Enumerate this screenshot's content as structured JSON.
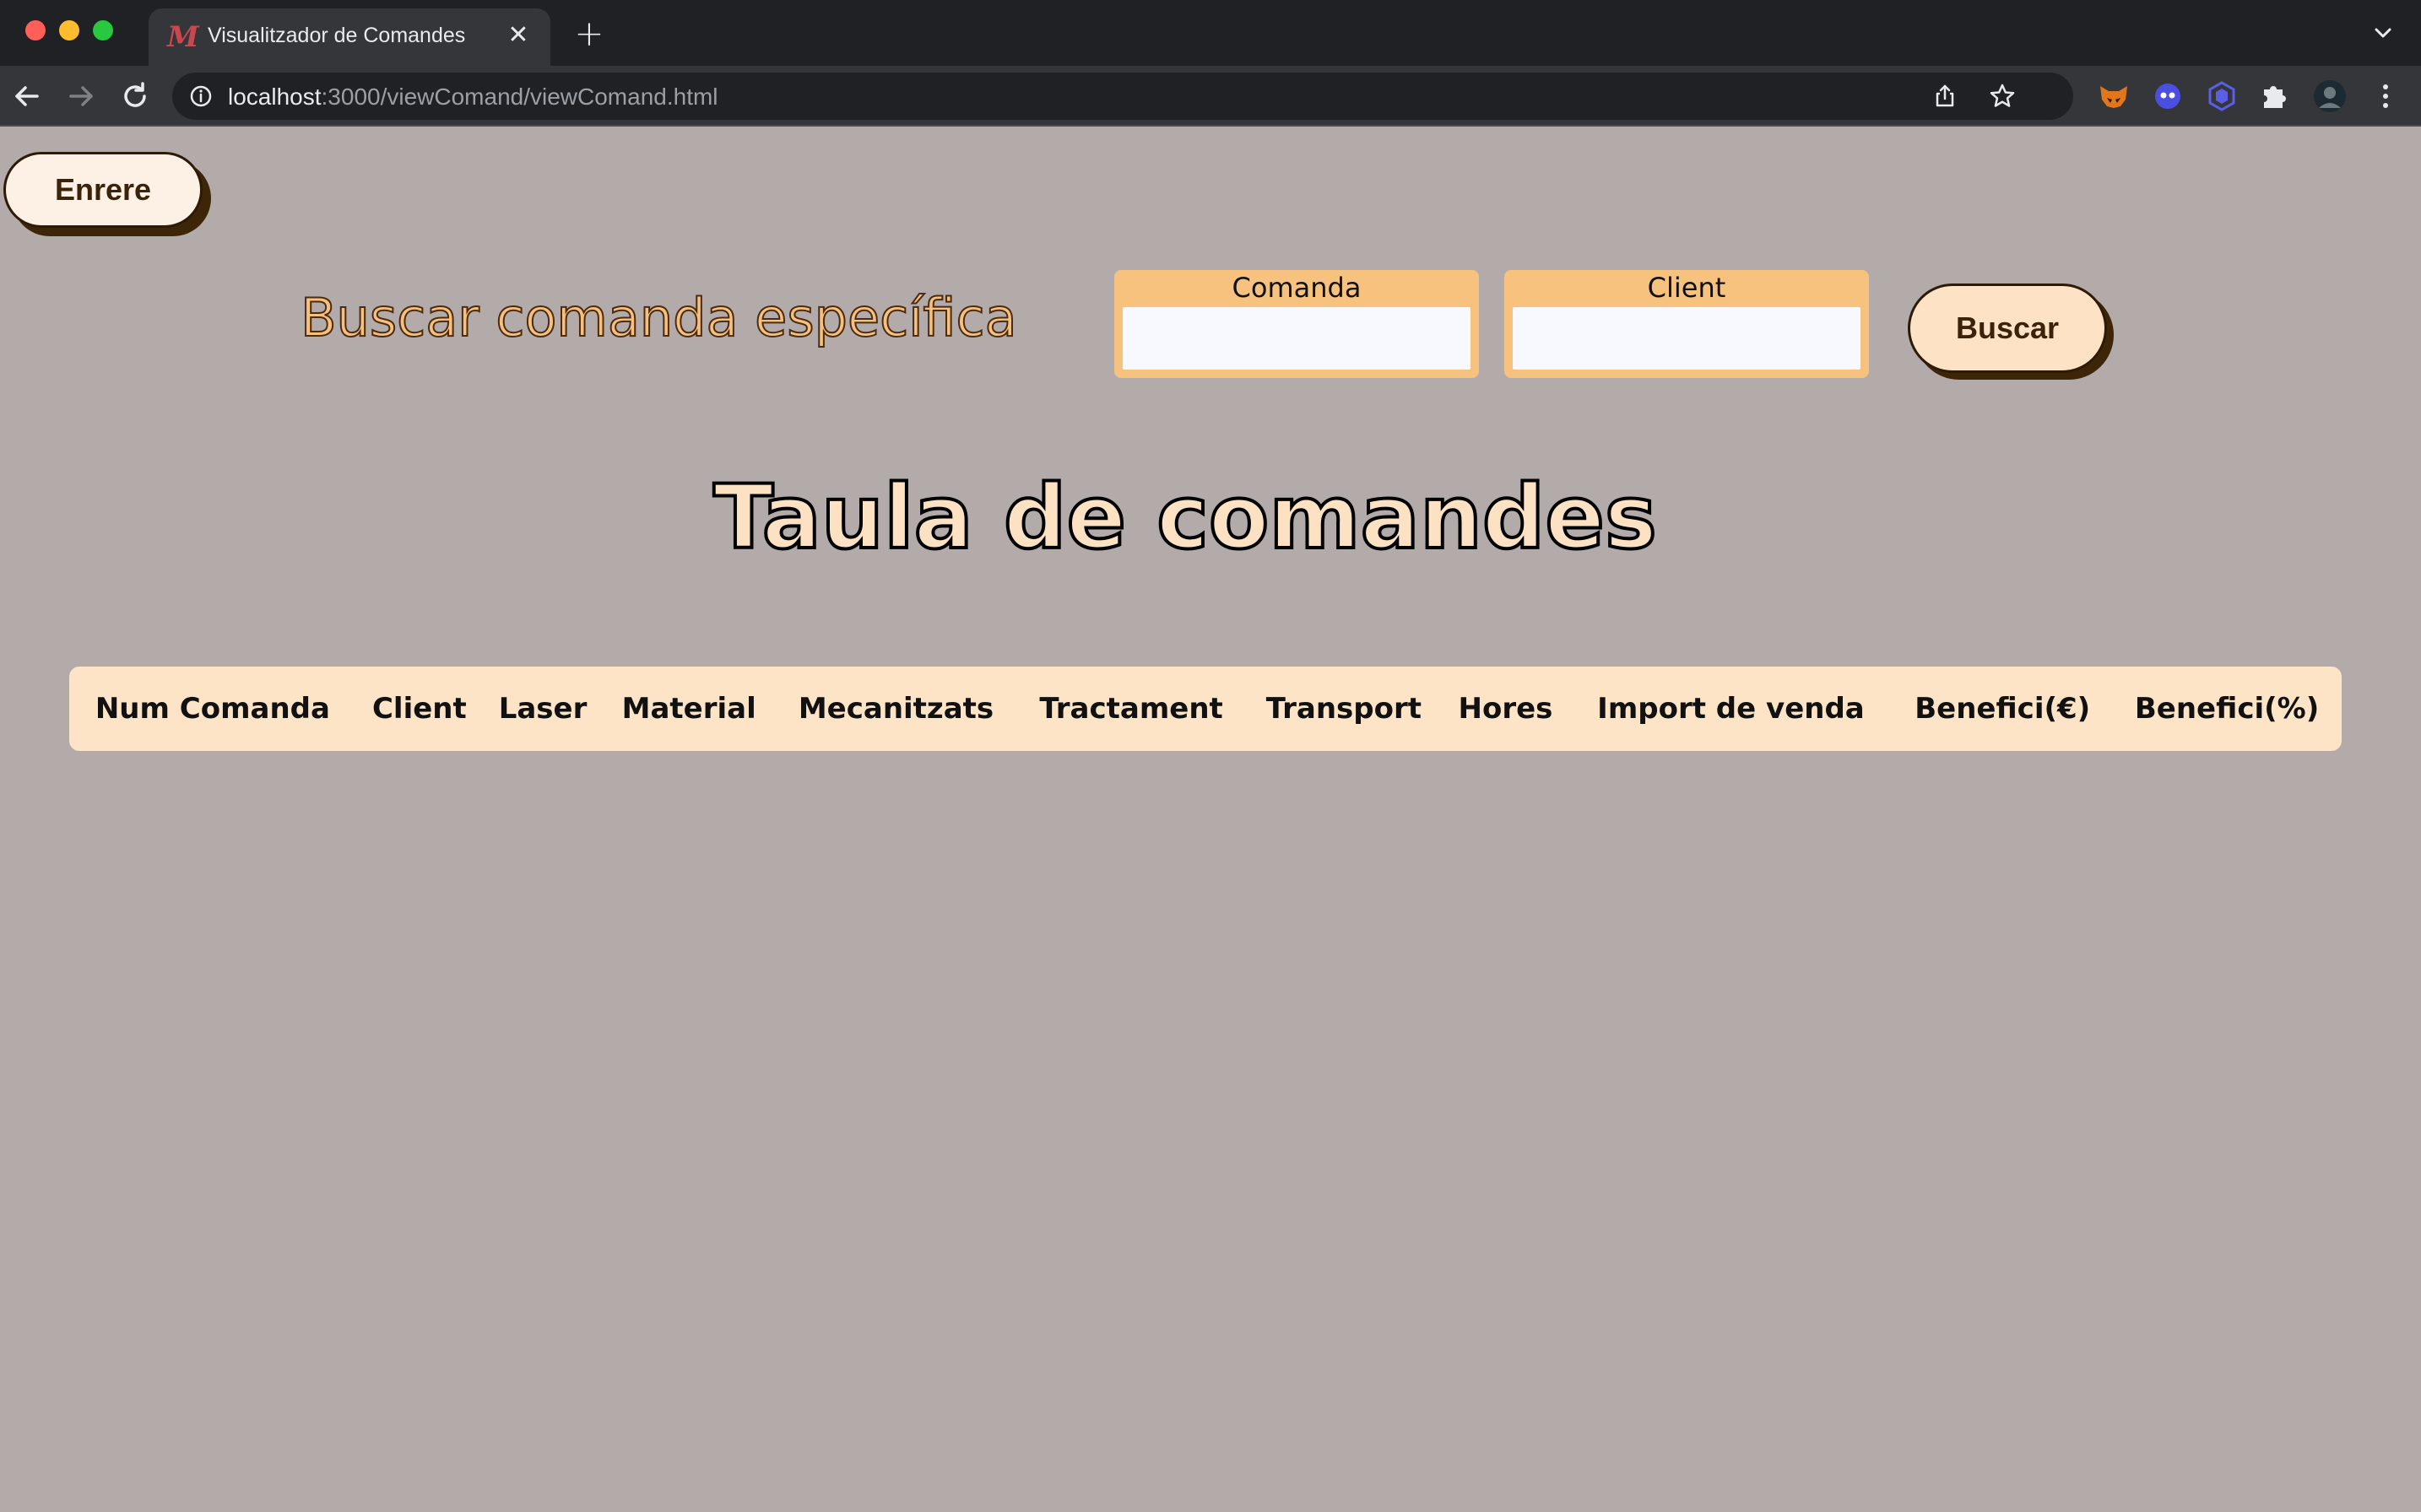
{
  "browser": {
    "tab_title": "Visualitzador de Comandes",
    "tab_favicon": "M",
    "tab_close": "✕",
    "new_tab": "+",
    "url_host": "localhost",
    "url_rest": ":3000/viewComand/viewComand.html"
  },
  "page": {
    "back_button": "Enrere",
    "search_title": "Buscar comanda específica",
    "fields": [
      {
        "label": "Comanda",
        "value": ""
      },
      {
        "label": "Client",
        "value": ""
      }
    ],
    "search_button": "Buscar",
    "table_title": "Taula de comandes",
    "table_headers": [
      "Num Comanda",
      "Client",
      "Laser",
      "Material",
      "Mecanitzats",
      "Tractament",
      "Transport",
      "Hores",
      "Import de venda",
      "Benefici(€)",
      "Benefici(%)"
    ]
  },
  "colors": {
    "page_bg": "#b3aaaa",
    "accent_orange": "#f7c17e",
    "table_bg": "#fde4c7",
    "button_bg": "#fcf1e4",
    "dark_brown": "#3a230b"
  },
  "icons": {
    "back": "arrow-left-icon",
    "forward": "arrow-right-icon",
    "reload": "reload-icon",
    "info": "info-icon",
    "share": "share-icon",
    "bookmark": "star-icon",
    "extensions": "puzzle-icon",
    "menu": "kebab-menu-icon",
    "tab_search": "chevron-down-icon"
  }
}
